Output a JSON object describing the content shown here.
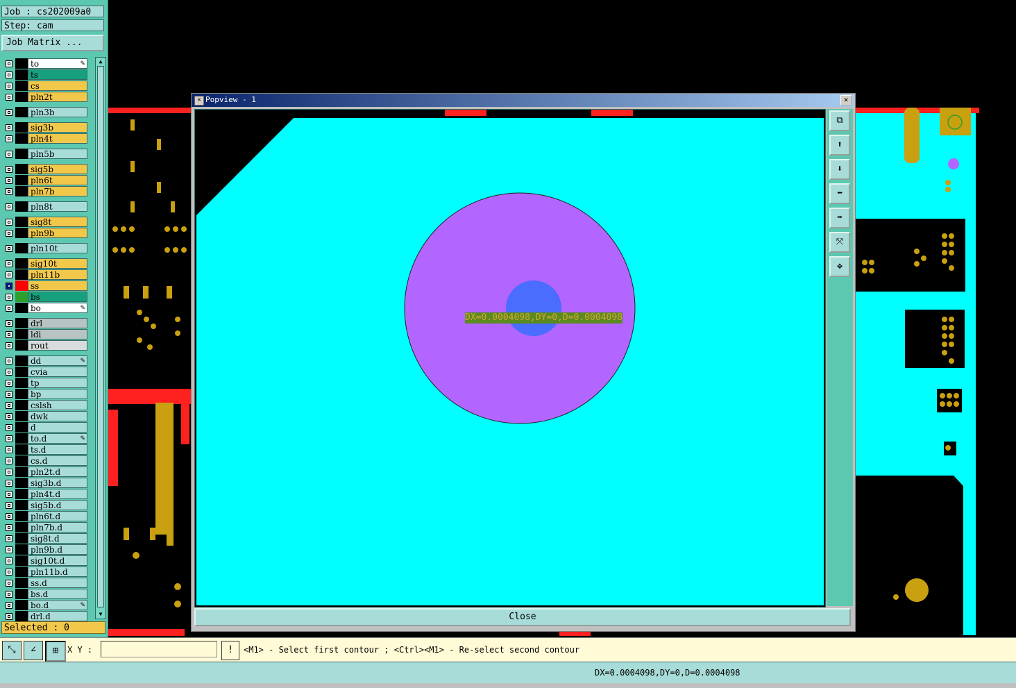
{
  "job": {
    "job_label": "Job : cs202009a0",
    "step_label": "Step: cam",
    "matrix_button": "Job Matrix ..."
  },
  "layers": [
    {
      "name": "to",
      "color": "#ffffff",
      "slot": "#000000",
      "pen": true,
      "group": 0
    },
    {
      "name": "ts",
      "color": "#16a07c",
      "slot": "#000000",
      "pen": false,
      "group": 0
    },
    {
      "name": "cs",
      "color": "#f2c84b",
      "slot": "#000000",
      "pen": false,
      "group": 0
    },
    {
      "name": "pln2t",
      "color": "#f2c84b",
      "slot": "#000000",
      "pen": false,
      "group": 0
    },
    {
      "name": "pln3b",
      "color": "#a8dcd8",
      "slot": "#000000",
      "pen": false,
      "group": 1
    },
    {
      "name": "sig3b",
      "color": "#f2c84b",
      "slot": "#000000",
      "pen": false,
      "group": 2
    },
    {
      "name": "pln4t",
      "color": "#f2c84b",
      "slot": "#000000",
      "pen": false,
      "group": 2
    },
    {
      "name": "pln5b",
      "color": "#a8dcd8",
      "slot": "#000000",
      "pen": false,
      "group": 3
    },
    {
      "name": "sig5b",
      "color": "#f2c84b",
      "slot": "#000000",
      "pen": false,
      "group": 4
    },
    {
      "name": "pln6t",
      "color": "#f2c84b",
      "slot": "#000000",
      "pen": false,
      "group": 4
    },
    {
      "name": "pln7b",
      "color": "#f2c84b",
      "slot": "#000000",
      "pen": false,
      "group": 4
    },
    {
      "name": "pln8t",
      "color": "#a8dcd8",
      "slot": "#000000",
      "pen": false,
      "group": 5
    },
    {
      "name": "sig8t",
      "color": "#f2c84b",
      "slot": "#000000",
      "pen": false,
      "group": 6
    },
    {
      "name": "pln9b",
      "color": "#f2c84b",
      "slot": "#000000",
      "pen": false,
      "group": 6
    },
    {
      "name": "pln10t",
      "color": "#a8dcd8",
      "slot": "#000000",
      "pen": false,
      "group": 7
    },
    {
      "name": "sig10t",
      "color": "#f2c84b",
      "slot": "#000000",
      "pen": false,
      "group": 8
    },
    {
      "name": "pln11b",
      "color": "#f2c84b",
      "slot": "#000000",
      "pen": false,
      "group": 8
    },
    {
      "name": "ss",
      "color": "#f2c84b",
      "slot": "#ff0000",
      "pen": false,
      "active": true,
      "group": 8
    },
    {
      "name": "bs",
      "color": "#16a07c",
      "slot": "#2ea02e",
      "pen": false,
      "group": 8
    },
    {
      "name": "bo",
      "color": "#ffffff",
      "slot": "#000000",
      "pen": true,
      "group": 8
    },
    {
      "name": "drl",
      "color": "#b8c4c4",
      "slot": "#000000",
      "pen": false,
      "group": 9
    },
    {
      "name": "ldi",
      "color": "#b8c4c4",
      "slot": "#000000",
      "pen": false,
      "group": 9
    },
    {
      "name": "rout",
      "color": "#d8dcdc",
      "slot": "#000000",
      "pen": false,
      "group": 9
    },
    {
      "name": "dd",
      "color": "#a8dcd8",
      "slot": "#000000",
      "pen": true,
      "group": 10
    },
    {
      "name": "cvia",
      "color": "#a8dcd8",
      "slot": "#000000",
      "pen": false,
      "group": 10
    },
    {
      "name": "tp",
      "color": "#a8dcd8",
      "slot": "#000000",
      "pen": false,
      "group": 10
    },
    {
      "name": "bp",
      "color": "#a8dcd8",
      "slot": "#000000",
      "pen": false,
      "group": 10
    },
    {
      "name": "cslsh",
      "color": "#a8dcd8",
      "slot": "#000000",
      "pen": false,
      "group": 10
    },
    {
      "name": "dwk",
      "color": "#a8dcd8",
      "slot": "#000000",
      "pen": false,
      "group": 10
    },
    {
      "name": "d",
      "color": "#a8dcd8",
      "slot": "#000000",
      "pen": false,
      "group": 10
    },
    {
      "name": "to.d",
      "color": "#a8dcd8",
      "slot": "#000000",
      "pen": true,
      "group": 10
    },
    {
      "name": "ts.d",
      "color": "#a8dcd8",
      "slot": "#000000",
      "pen": false,
      "group": 10
    },
    {
      "name": "cs.d",
      "color": "#a8dcd8",
      "slot": "#000000",
      "pen": false,
      "group": 10
    },
    {
      "name": "pln2t.d",
      "color": "#a8dcd8",
      "slot": "#000000",
      "pen": false,
      "group": 10
    },
    {
      "name": "sig3b.d",
      "color": "#a8dcd8",
      "slot": "#000000",
      "pen": false,
      "group": 10
    },
    {
      "name": "pln4t.d",
      "color": "#a8dcd8",
      "slot": "#000000",
      "pen": false,
      "group": 10
    },
    {
      "name": "sig5b.d",
      "color": "#a8dcd8",
      "slot": "#000000",
      "pen": false,
      "group": 10
    },
    {
      "name": "pln6t.d",
      "color": "#a8dcd8",
      "slot": "#000000",
      "pen": false,
      "group": 10
    },
    {
      "name": "pln7b.d",
      "color": "#a8dcd8",
      "slot": "#000000",
      "pen": false,
      "group": 10
    },
    {
      "name": "sig8t.d",
      "color": "#a8dcd8",
      "slot": "#000000",
      "pen": false,
      "group": 10
    },
    {
      "name": "pln9b.d",
      "color": "#a8dcd8",
      "slot": "#000000",
      "pen": false,
      "group": 10
    },
    {
      "name": "sig10t.d",
      "color": "#a8dcd8",
      "slot": "#000000",
      "pen": false,
      "group": 10
    },
    {
      "name": "pln11b.d",
      "color": "#a8dcd8",
      "slot": "#000000",
      "pen": false,
      "group": 10
    },
    {
      "name": "ss.d",
      "color": "#a8dcd8",
      "slot": "#000000",
      "pen": false,
      "group": 10
    },
    {
      "name": "bs.d",
      "color": "#a8dcd8",
      "slot": "#000000",
      "pen": false,
      "group": 10
    },
    {
      "name": "bo.d",
      "color": "#a8dcd8",
      "slot": "#000000",
      "pen": true,
      "group": 10
    },
    {
      "name": "drl.d",
      "color": "#a8dcd8",
      "slot": "#000000",
      "pen": false,
      "group": 10
    }
  ],
  "selected_label": "Selected : 0",
  "popview": {
    "title": "Popview - 1",
    "close_label": "Close",
    "measure_label": "DX=0.0004098,DY=0,D=0.0004098",
    "tools": [
      "zoom-window-icon",
      "zoom-in-icon",
      "zoom-out-icon",
      "pan-left-icon",
      "pan-right-icon",
      "fit-icon",
      "pan-all-icon"
    ]
  },
  "command": {
    "xy_label": "X Y :",
    "xy_value": "",
    "info_symbol": "!",
    "prompt": "<M1> - Select first contour ; <Ctrl><M1> - Re-select second contour"
  },
  "status": {
    "text": "DX=0.0004098,DY=0,D=0.0004098"
  },
  "colors": {
    "panel": "#5cc8b0",
    "cyan_copper": "#00ffff",
    "pad_purple": "#b266ff",
    "drill_blue": "#4a6cff",
    "pad_gold": "#c8a010",
    "trace_red": "#ff2020"
  }
}
